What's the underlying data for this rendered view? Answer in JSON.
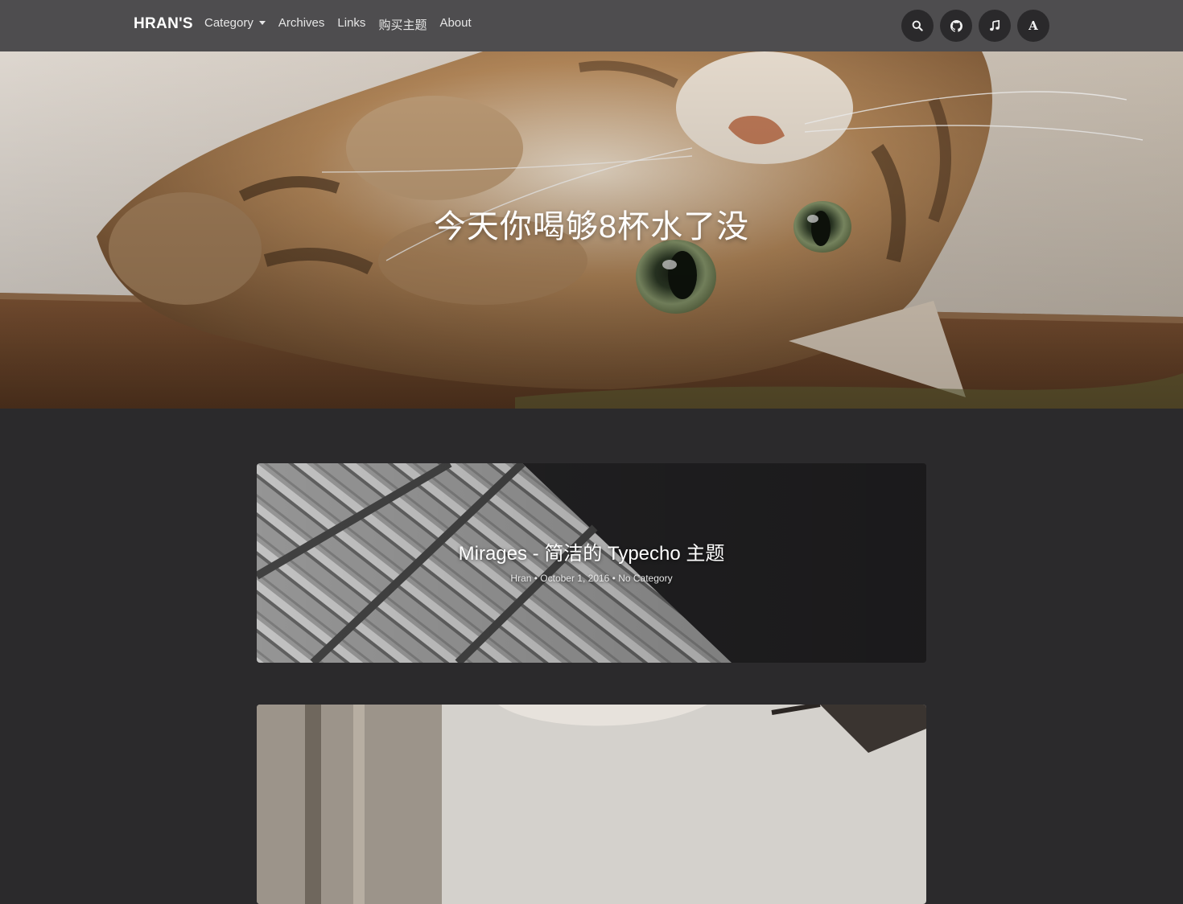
{
  "navbar": {
    "brand": "HRAN'S",
    "links": [
      {
        "label": "Category",
        "has_caret": true
      },
      {
        "label": "Archives"
      },
      {
        "label": "Links"
      },
      {
        "label": "购买主题"
      },
      {
        "label": "About"
      }
    ],
    "buttons": [
      {
        "icon": "search-icon"
      },
      {
        "icon": "github-icon"
      },
      {
        "icon": "music-icon"
      },
      {
        "icon": "font-icon",
        "text": "A"
      }
    ]
  },
  "hero": {
    "title": "今天你喝够8杯水了没"
  },
  "posts": [
    {
      "title": "Mirages - 简洁的 Typecho 主题",
      "author": "Hran",
      "date": "October 1, 2016",
      "category": "No Category",
      "meta": "Hran • October 1, 2016 • No Category"
    }
  ],
  "colors": {
    "navbar_bg": "#4e4d4f",
    "page_bg": "#2b2a2c",
    "button_bg": "#2a292b"
  }
}
